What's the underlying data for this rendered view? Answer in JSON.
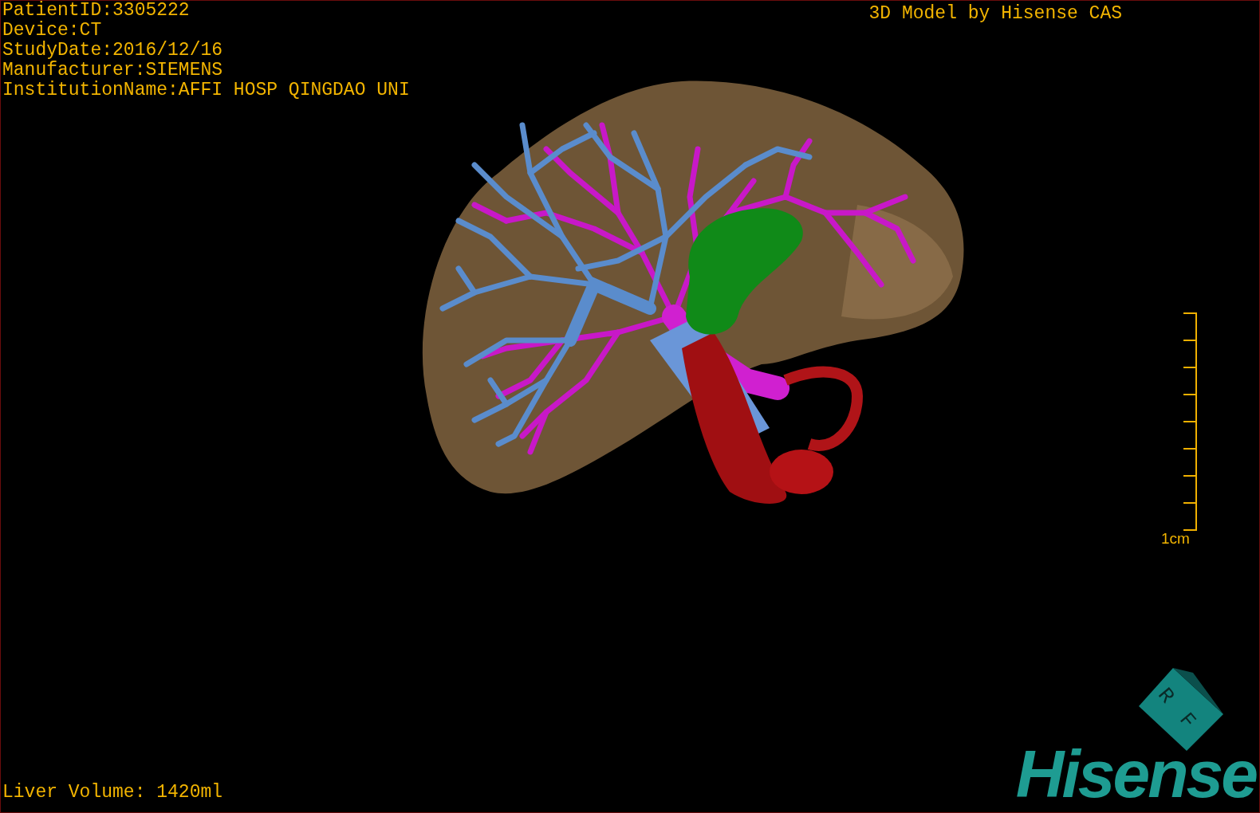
{
  "overlay": {
    "patient_info": [
      "PatientID:3305222",
      "Device:CT",
      "StudyDate:2016/12/16",
      "Manufacturer:SIEMENS",
      "InstitutionName:AFFI HOSP QINGDAO UNI"
    ],
    "title": "3D Model by Hisense CAS",
    "liver_volume": "Liver Volume: 1420ml"
  },
  "scale_bar": {
    "label": "1cm"
  },
  "orientation_cube": {
    "faces": [
      "R",
      "F"
    ]
  },
  "logo": "Hisense"
}
